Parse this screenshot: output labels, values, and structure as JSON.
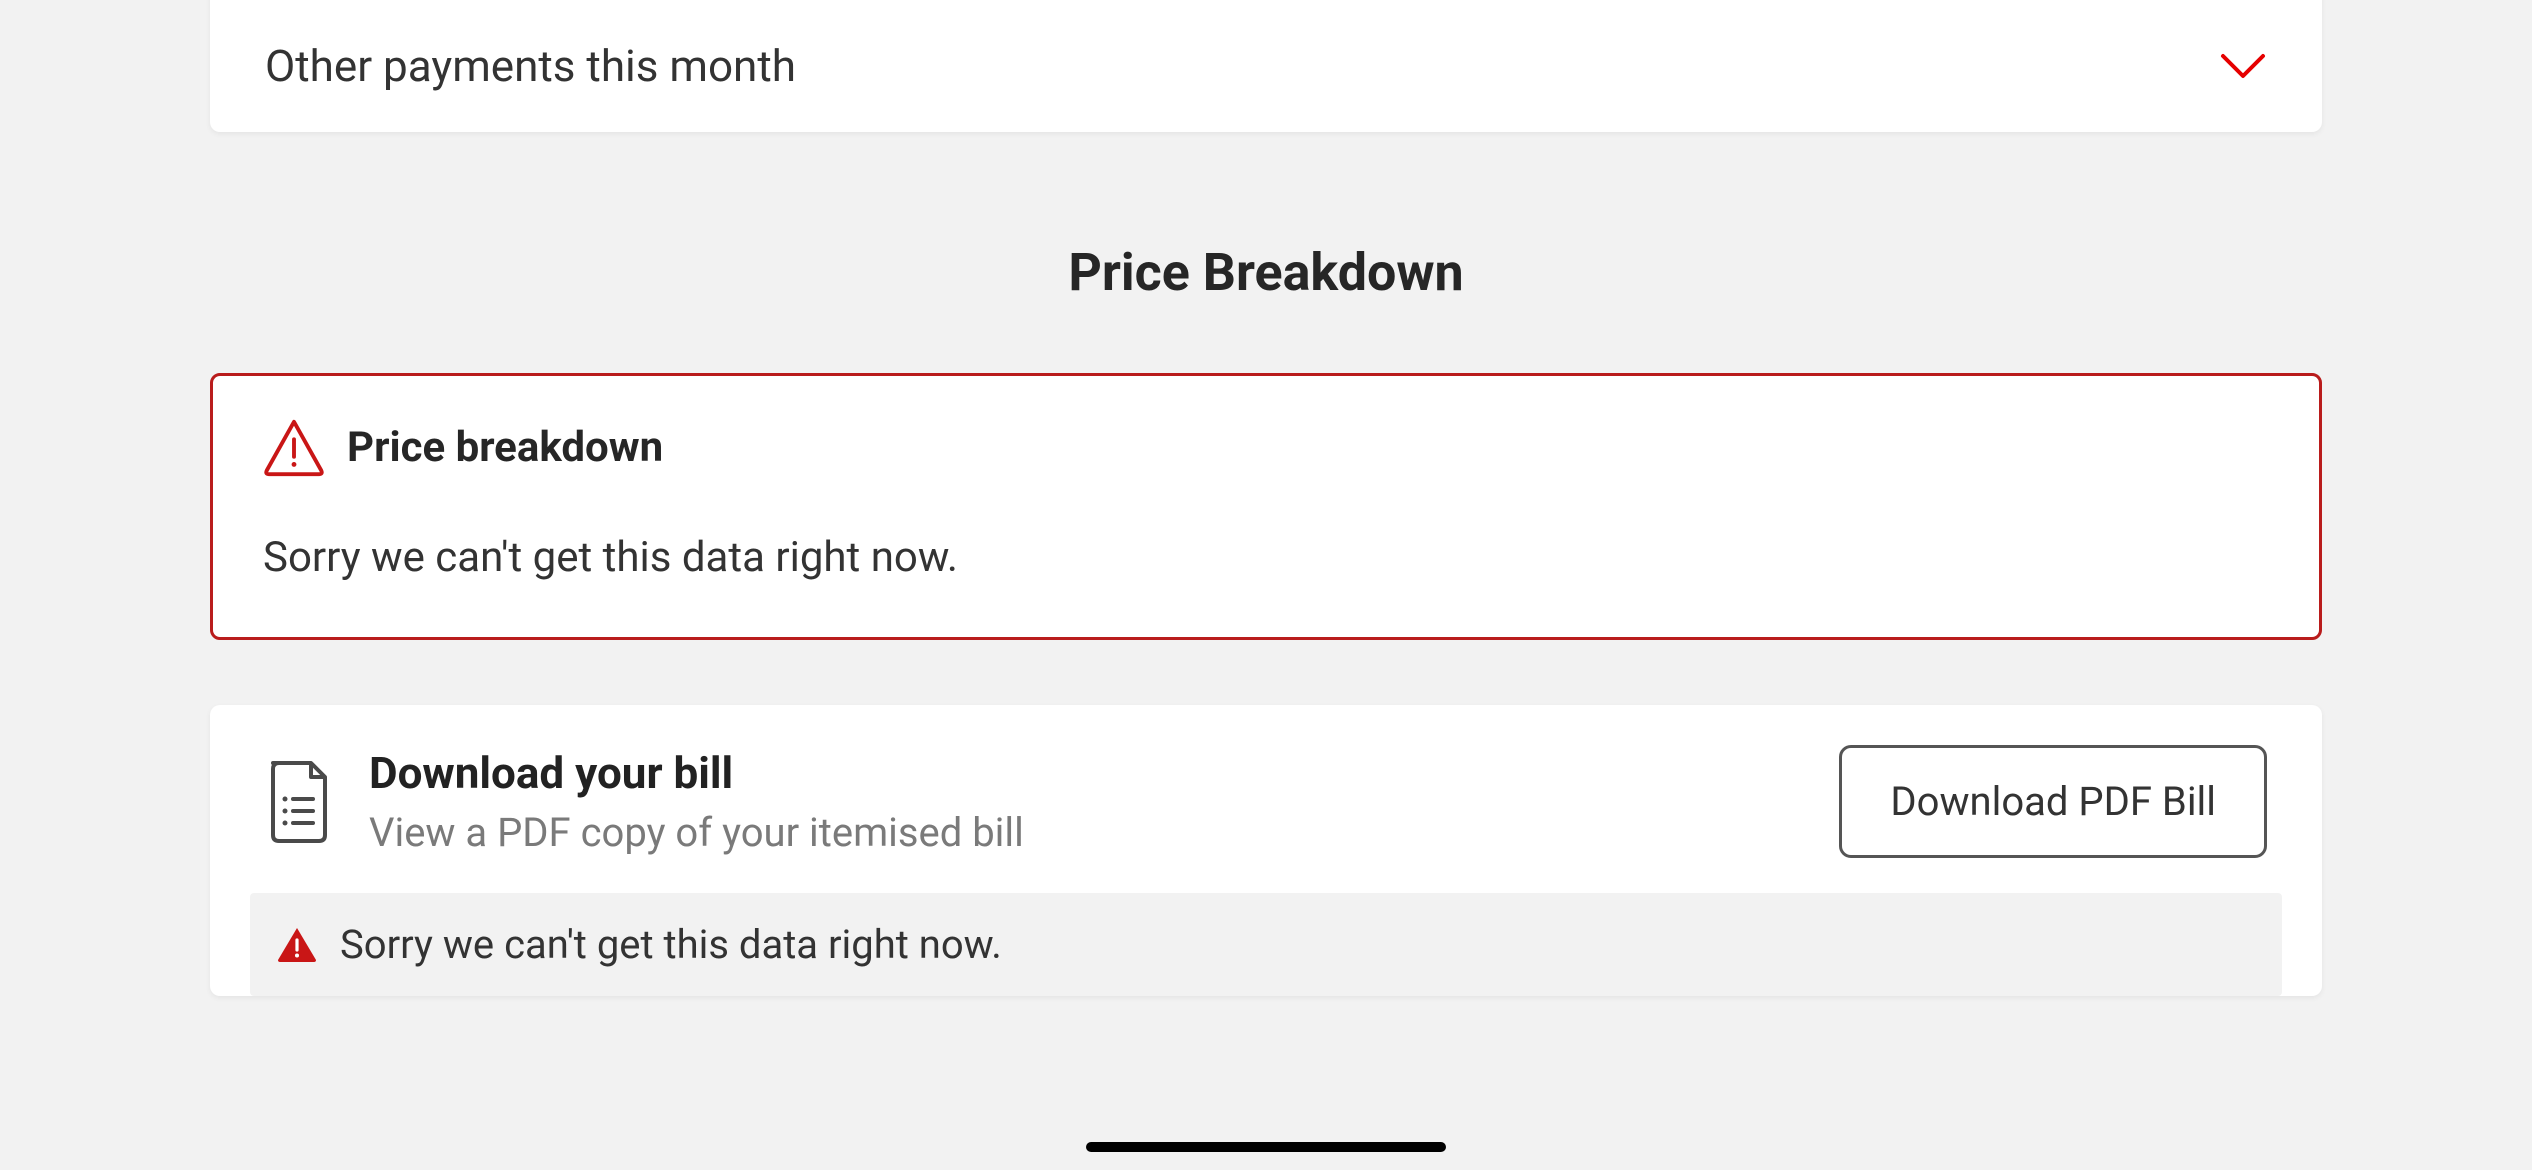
{
  "accordion": {
    "label": "Other payments this month"
  },
  "section": {
    "title": "Price Breakdown"
  },
  "alert": {
    "title": "Price breakdown",
    "message": "Sorry we can't get this data right now."
  },
  "download": {
    "title": "Download your bill",
    "subtitle": "View a PDF copy of your itemised bill",
    "button": "Download PDF Bill"
  },
  "inline_error": {
    "message": "Sorry we can't get this data right now."
  },
  "colors": {
    "accent_red": "#e60000",
    "border_red": "#b91c1c"
  }
}
